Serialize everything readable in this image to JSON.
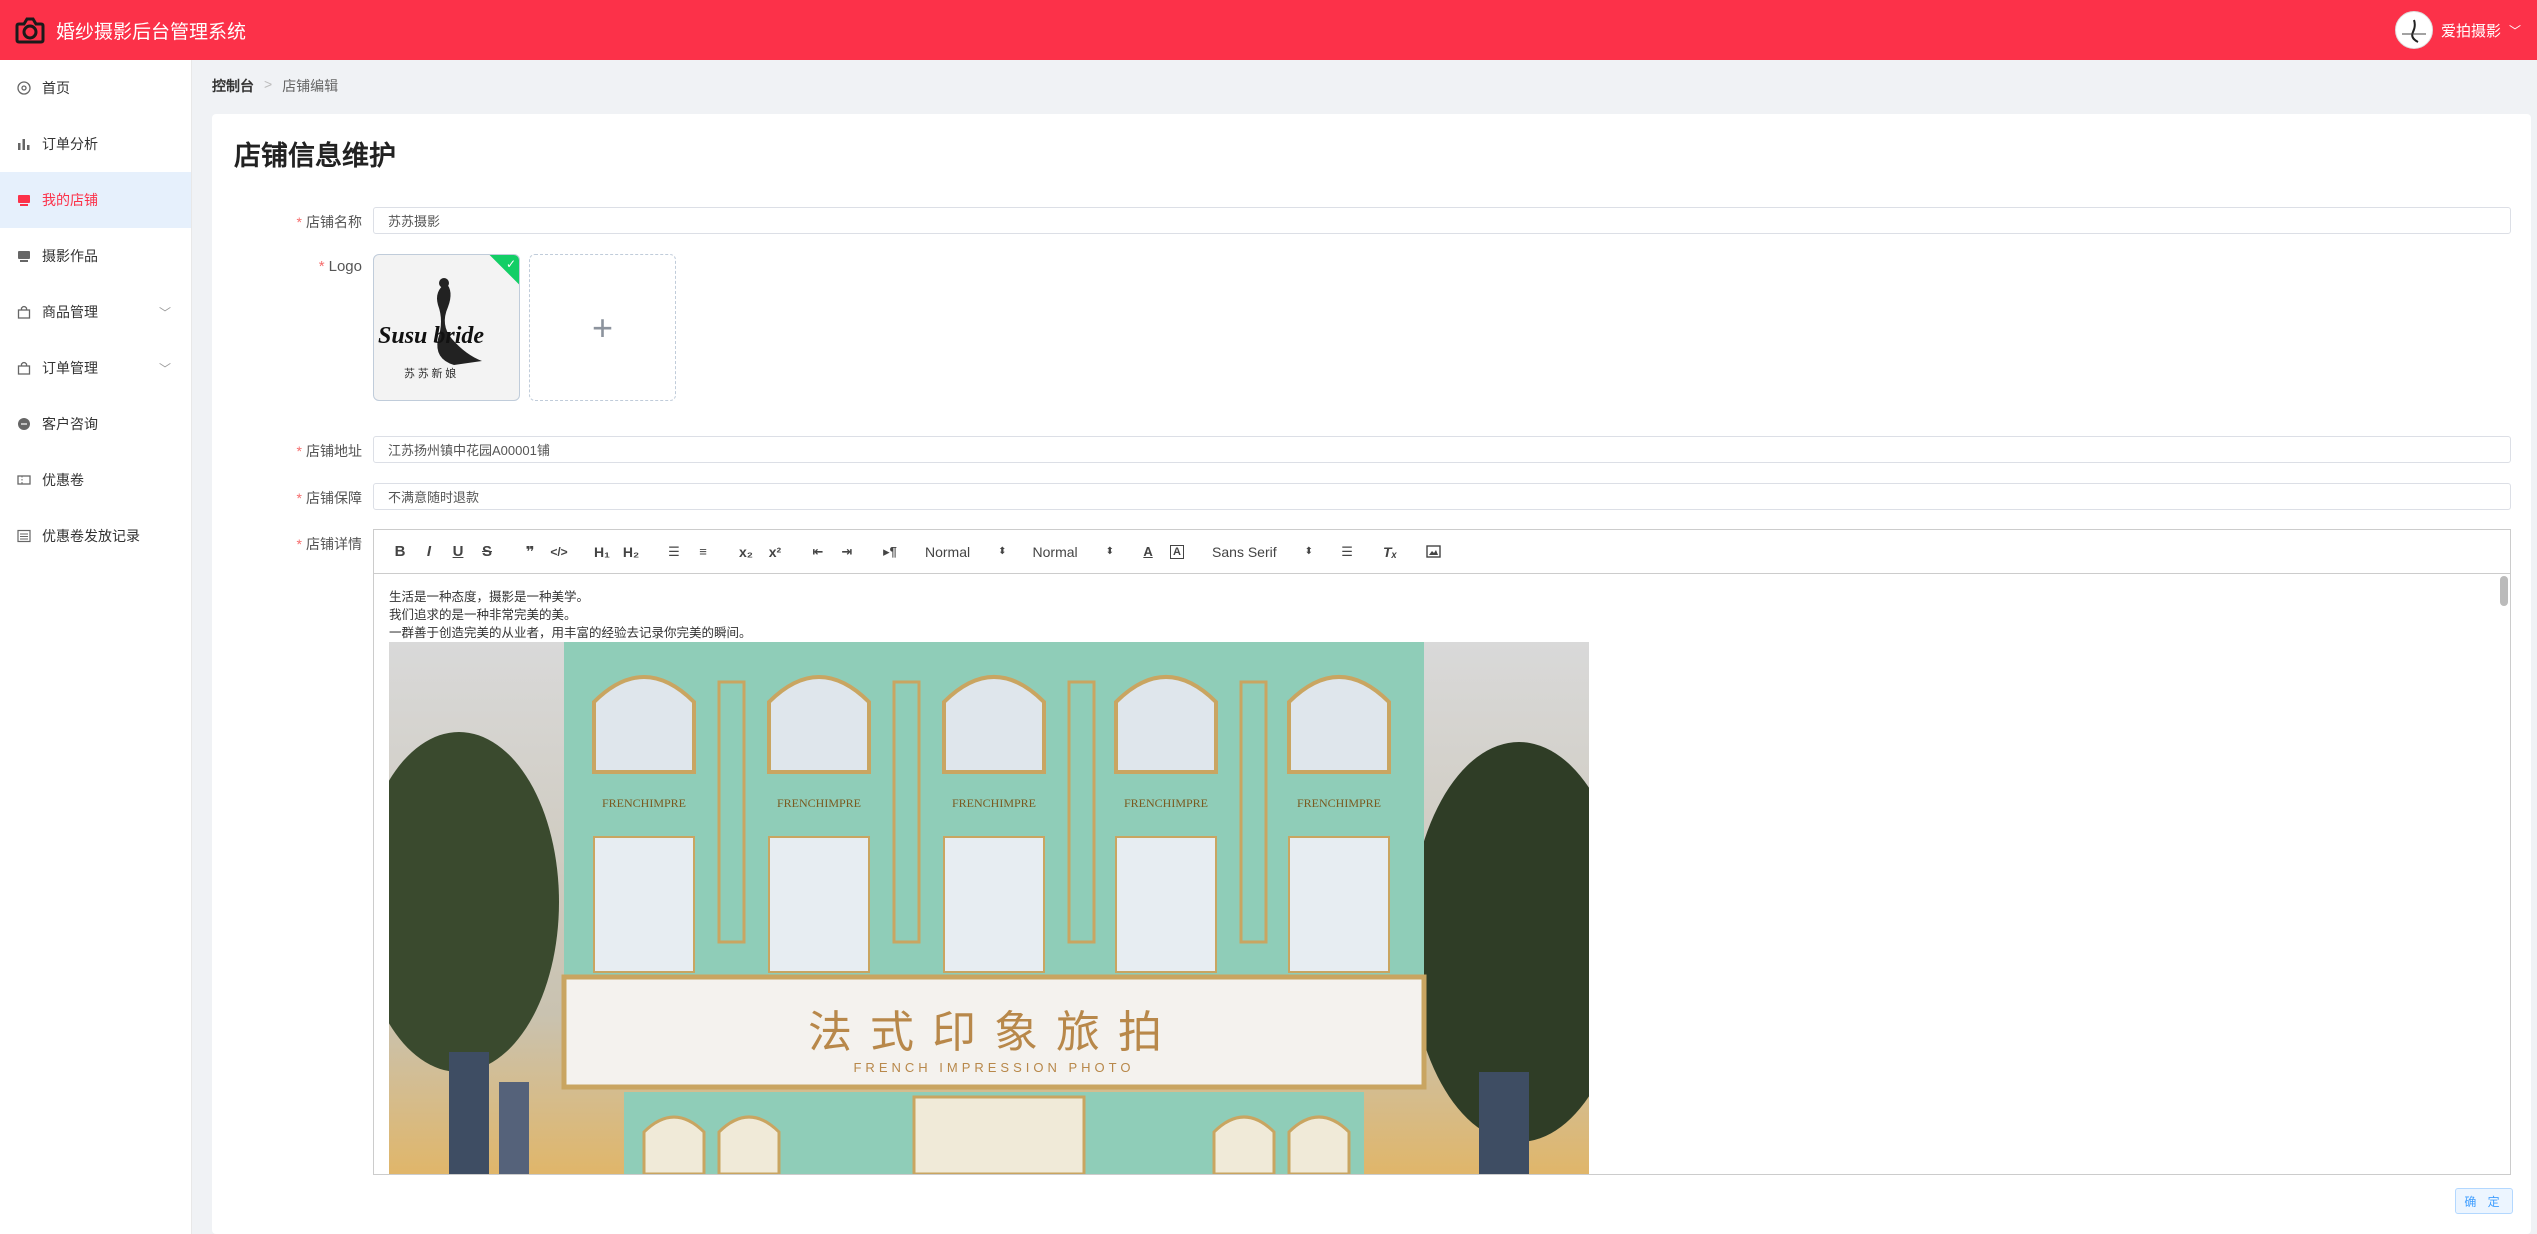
{
  "app": {
    "title": "婚纱摄影后台管理系统",
    "user_name": "爱拍摄影"
  },
  "sidebar": {
    "items": [
      {
        "label": "首页",
        "icon": "home-icon",
        "active": false,
        "expandable": false
      },
      {
        "label": "订单分析",
        "icon": "bar-chart-icon",
        "active": false,
        "expandable": false
      },
      {
        "label": "我的店铺",
        "icon": "shop-icon",
        "active": true,
        "expandable": false
      },
      {
        "label": "摄影作品",
        "icon": "photo-icon",
        "active": false,
        "expandable": false
      },
      {
        "label": "商品管理",
        "icon": "bag-icon",
        "active": false,
        "expandable": true
      },
      {
        "label": "订单管理",
        "icon": "bag-icon",
        "active": false,
        "expandable": true
      },
      {
        "label": "客户咨询",
        "icon": "chat-icon",
        "active": false,
        "expandable": false
      },
      {
        "label": "优惠卷",
        "icon": "ticket-icon",
        "active": false,
        "expandable": false
      },
      {
        "label": "优惠卷发放记录",
        "icon": "list-icon",
        "active": false,
        "expandable": false
      }
    ]
  },
  "breadcrumb": {
    "root": "控制台",
    "current": "店铺编辑"
  },
  "page": {
    "title": "店铺信息维护"
  },
  "form": {
    "name_label": "店铺名称",
    "name_value": "苏苏摄影",
    "logo_label": "Logo",
    "logo_text": "Susu bride",
    "logo_subtext": "苏 苏 新 娘",
    "address_label": "店铺地址",
    "address_value": "江苏扬州镇中花园A00001铺",
    "guarantee_label": "店铺保障",
    "guarantee_value": "不满意随时退款",
    "detail_label": "店铺详情",
    "submit_label": "确 定"
  },
  "editor": {
    "toolbar": {
      "header_select": "Normal",
      "size_select": "Normal",
      "font_select": "Sans Serif"
    },
    "lines": [
      "生活是一种态度，摄影是一种美学。",
      "我们追求的是一种非常完美的美。",
      "一群善于创造完美的从业者，用丰富的经验去记录你完美的瞬间。"
    ],
    "image": {
      "sign_cn": "法式印象旅拍",
      "sign_en": "FRENCH IMPRESSION PHOTO",
      "window_text": "FRENCHIMPRE"
    }
  },
  "colors": {
    "brand": "#fc3149",
    "active_bg": "#e6f0fc",
    "success": "#13ce66",
    "storefront": "#8fcdb8"
  }
}
